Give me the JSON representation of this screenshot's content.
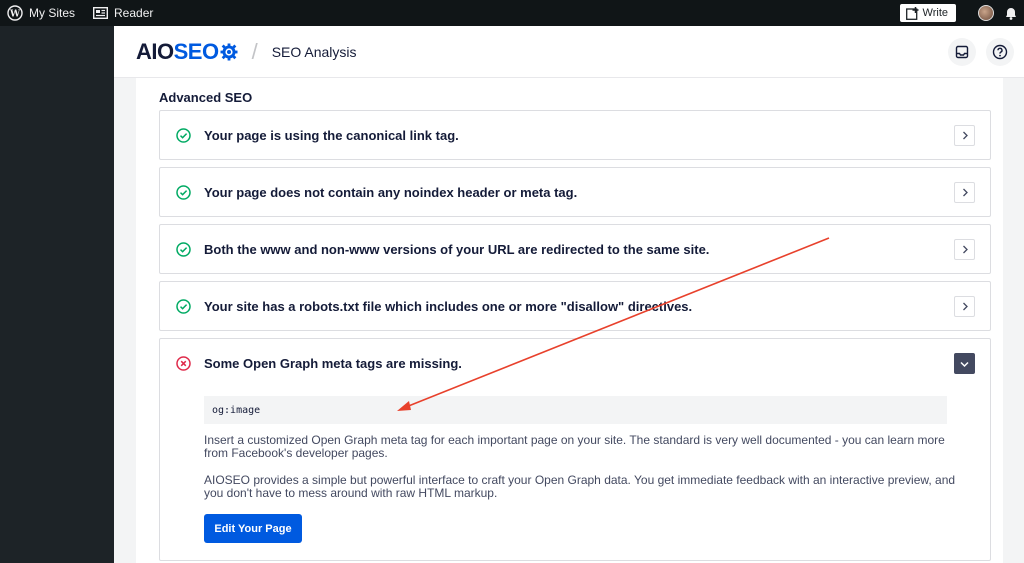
{
  "adminbar": {
    "my_sites": "My Sites",
    "reader": "Reader",
    "write": "Write"
  },
  "header": {
    "logo_aio": "AIO",
    "logo_seo": "SEO",
    "page_title": "SEO Analysis"
  },
  "section": {
    "title": "Advanced SEO"
  },
  "checks": [
    {
      "status": "pass",
      "message": "Your page is using the canonical link tag."
    },
    {
      "status": "pass",
      "message": "Your page does not contain any noindex header or meta tag."
    },
    {
      "status": "pass",
      "message": "Both the www and non-www versions of your URL are redirected to the same site."
    },
    {
      "status": "pass",
      "message": "Your site has a robots.txt file which includes one or more \"disallow\" directives."
    },
    {
      "status": "fail",
      "message": "Some Open Graph meta tags are missing."
    }
  ],
  "expanded": {
    "code": "og:image",
    "paragraph1_line1": "Insert a customized Open Graph meta tag for each important page on your site. The standard is very well documented - you can learn more",
    "paragraph1_line2": "from Facebook's developer pages.",
    "paragraph2_line1": "AIOSEO provides a simple but powerful interface to craft your Open Graph data. You get immediate feedback with an interactive preview, and",
    "paragraph2_line2": "you don't have to mess around with raw HTML markup.",
    "button": "Edit Your Page"
  },
  "colors": {
    "pass": "#00aa63",
    "fail": "#df2a4a",
    "brand": "#005ae0",
    "arrow": "#e8412c"
  },
  "icons": [
    "wordpress-icon",
    "reader-icon",
    "write-icon",
    "bell-icon",
    "inbox-icon",
    "help-icon",
    "check-circle-icon",
    "error-circle-icon",
    "chevron-right-icon",
    "chevron-down-icon"
  ]
}
